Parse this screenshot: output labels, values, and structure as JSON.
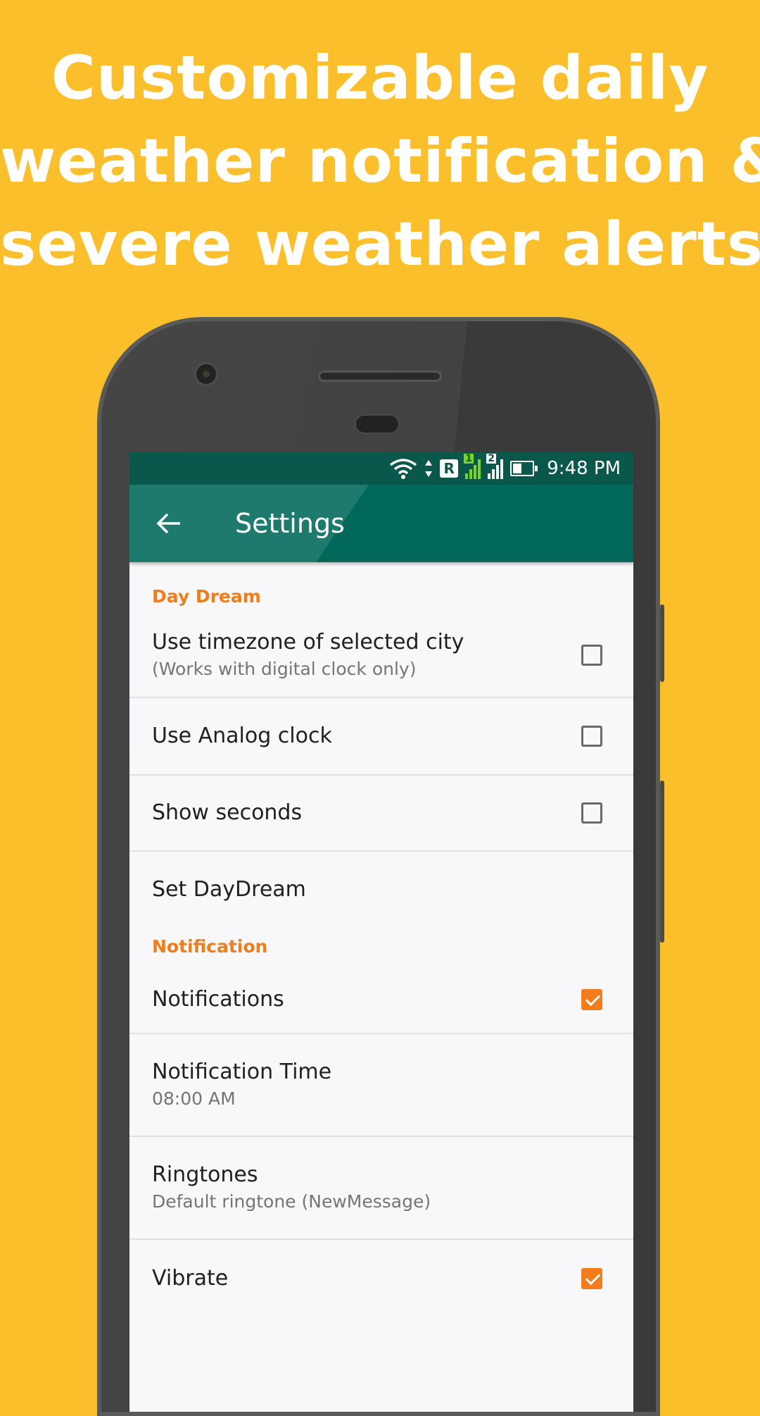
{
  "headline": {
    "line1": "Customizable daily",
    "line2": "weather notification &",
    "line3": "severe weather alerts"
  },
  "statusbar": {
    "roaming": "R",
    "sim1": "1",
    "sim2": "2",
    "time": "9:48 PM"
  },
  "appbar": {
    "title": "Settings"
  },
  "sections": {
    "daydream": {
      "header": "Day Dream",
      "timezone": {
        "title": "Use timezone of selected city",
        "subtitle": "(Works with digital clock only)",
        "checked": false
      },
      "analog": {
        "title": "Use Analog clock",
        "checked": false
      },
      "seconds": {
        "title": "Show seconds",
        "checked": false
      },
      "set_daydream": {
        "title": "Set DayDream"
      }
    },
    "notification": {
      "header": "Notification",
      "notifications": {
        "title": "Notifications",
        "checked": true
      },
      "time": {
        "title": "Notification Time",
        "subtitle": "08:00 AM"
      },
      "ringtones": {
        "title": "Ringtones",
        "subtitle": "Default ringtone (NewMessage)"
      },
      "vibrate": {
        "title": "Vibrate",
        "checked": true
      }
    }
  },
  "colors": {
    "background": "#fbbf2c",
    "appbar": "#02695a",
    "statusbar": "#0a574b",
    "accent": "#f57c1a"
  }
}
